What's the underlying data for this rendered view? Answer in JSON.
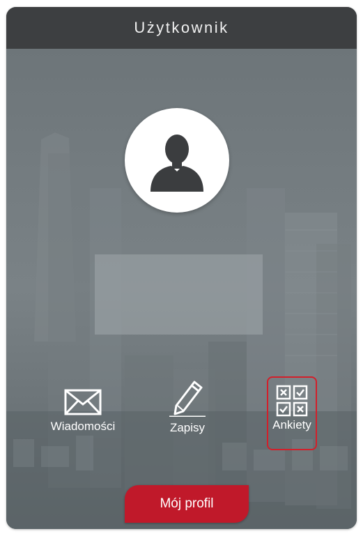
{
  "header": {
    "title": "Użytkownik"
  },
  "profile": {
    "avatar_icon": "user-silhouette-icon"
  },
  "actions": [
    {
      "label": "Wiadomości",
      "icon": "envelope-icon"
    },
    {
      "label": "Zapisy",
      "icon": "pencil-icon"
    },
    {
      "label": "Ankiety",
      "icon": "survey-checklist-icon"
    }
  ],
  "profile_button": {
    "label": "Mój profil"
  },
  "colors": {
    "header_bg": "#3d3f41",
    "accent": "#c0192a",
    "highlight_border": "#d31f2a",
    "card_bg": "#6b7478"
  }
}
